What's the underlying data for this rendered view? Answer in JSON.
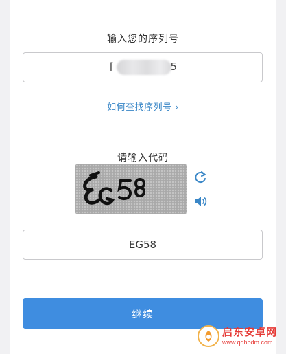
{
  "serial": {
    "label": "输入您的序列号",
    "prefix": "[",
    "suffix": "5"
  },
  "find_serial_link": "如何查找序列号 ›",
  "captcha": {
    "label": "请输入代码",
    "image_text": "EG58",
    "refresh_icon": "refresh-icon",
    "audio_icon": "speaker-icon"
  },
  "code_input": {
    "value": "EG58"
  },
  "continue_button": {
    "label": "继续"
  },
  "watermark": {
    "name": "启东安卓网",
    "url": "www.qdhbdm.com"
  },
  "colors": {
    "accent": "#3f8de0",
    "link": "#3a87c7",
    "watermark": "#e53935"
  }
}
